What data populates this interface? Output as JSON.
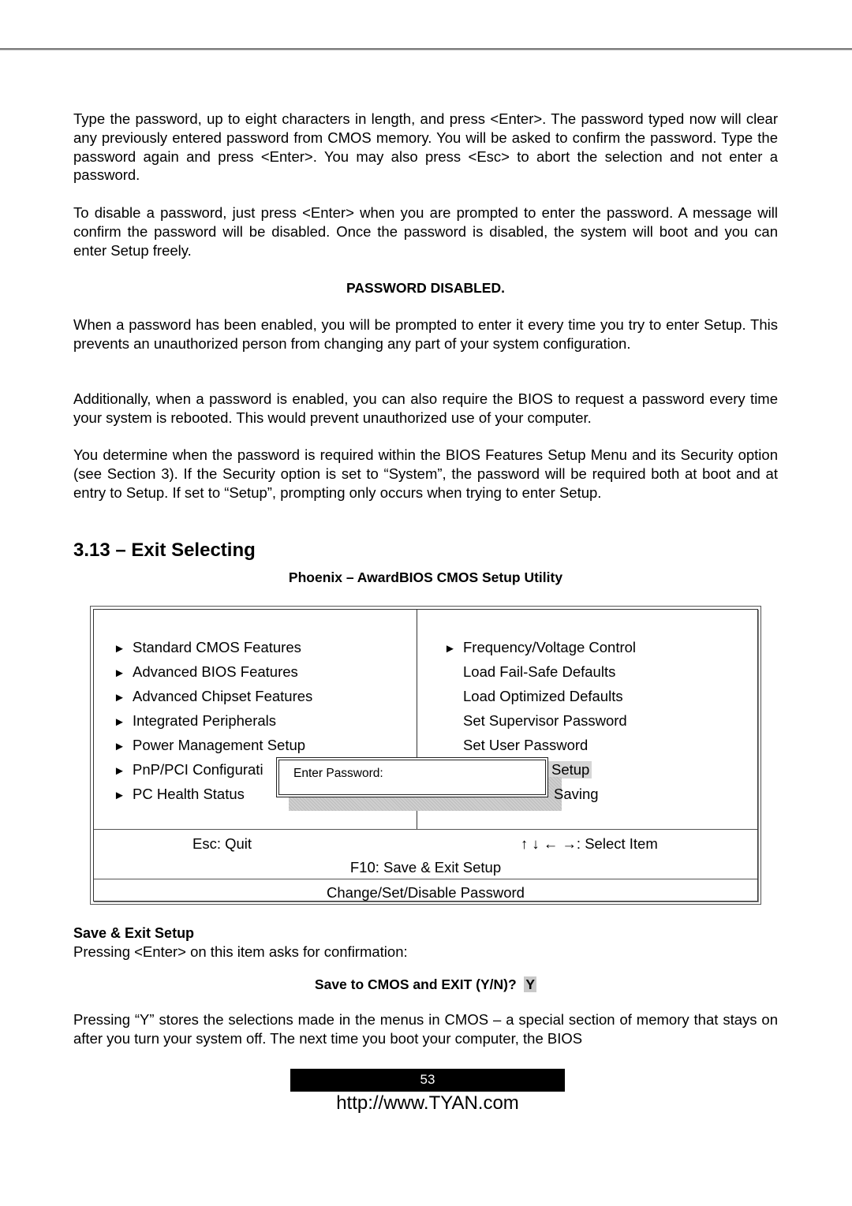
{
  "paragraphs": {
    "p1": "Type the password, up to eight characters in length, and press <Enter>.  The password typed now will clear any previously entered password from CMOS memory.  You will be asked to confirm the password.  Type the password again and press <Enter>.  You may also press <Esc> to abort the selection and not enter a password.",
    "p2": "To disable a password, just press <Enter> when you are prompted to enter the password.  A message will confirm the password will be disabled.  Once the password is disabled, the system will boot and you can enter Setup freely.",
    "password_disabled_heading": "PASSWORD DISABLED.",
    "p3": "When a password has been enabled, you will be prompted to enter it every time you try to enter Setup.  This prevents an unauthorized person from changing any part of your system configuration.",
    "p4": "Additionally, when a password is enabled, you can also require the BIOS to request a password every time your system is rebooted.  This would prevent unauthorized use of your computer.",
    "p5": "You determine when the password is required within the BIOS Features Setup Menu and its Security option (see Section 3).  If the Security option is set to “System”, the password will be required both at boot and at entry to Setup.  If set to “Setup”, prompting only occurs when trying to enter Setup."
  },
  "section": {
    "title": "3.13 – Exit Selecting",
    "bios_caption": "Phoenix – AwardBIOS CMOS Setup Utility"
  },
  "bios": {
    "arrow_glyph": "►",
    "left_menu": [
      "Standard CMOS Features",
      "Advanced BIOS Features",
      "Advanced Chipset Features",
      "Integrated Peripherals",
      "Power Management Setup",
      "PnP/PCI Configurati",
      "PC Health Status"
    ],
    "right_menu": [
      "Frequency/Voltage Control",
      "Load Fail-Safe Defaults",
      "Load Optimized Defaults",
      "Set Supervisor Password",
      "Set User Password",
      "Setup",
      "Saving"
    ],
    "dialog_label": "Enter Password:",
    "footer": {
      "esc": "Esc:  Quit",
      "select": "↑ ↓ ← →: Select Item",
      "f10": "F10:  Save & Exit Setup",
      "help": "Change/Set/Disable Password"
    }
  },
  "save_exit": {
    "heading": "Save & Exit Setup",
    "intro": "Pressing <Enter> on this item asks for confirmation:",
    "prompt": "Save to CMOS and EXIT (Y/N)?",
    "answer": "Y",
    "body": "Pressing “Y” stores the selections made in the menus in CMOS – a special section of memory that stays on after you turn your system off.  The next time you boot your computer, the BIOS"
  },
  "footer": {
    "page_number": "53",
    "url": "http://www.TYAN.com"
  }
}
